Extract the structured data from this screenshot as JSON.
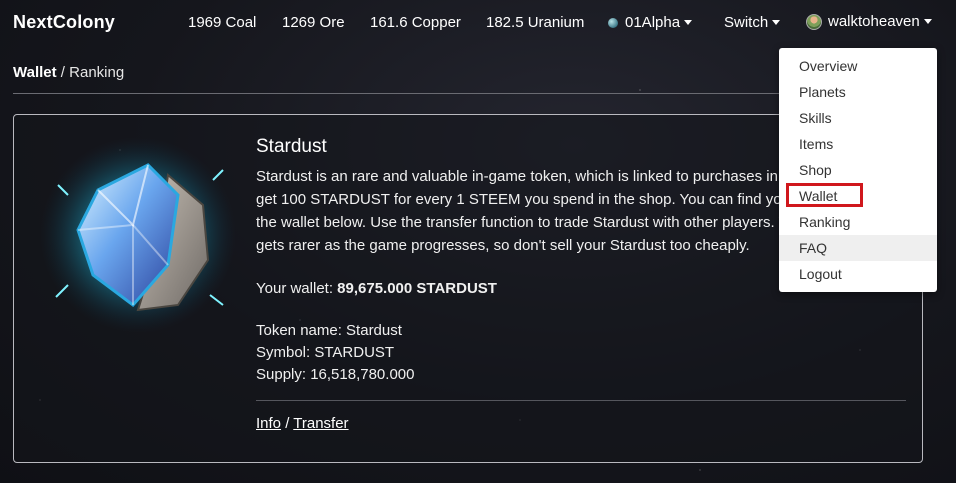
{
  "navbar": {
    "brand": "NextColony",
    "resources": {
      "coal": "1969 Coal",
      "ore": "1269 Ore",
      "copper": "161.6 Copper",
      "uranium": "182.5 Uranium"
    },
    "planet": "01Alpha",
    "switch_label": "Switch",
    "username": "walktoheaven"
  },
  "breadcrumb": {
    "wallet": "Wallet",
    "separator": "/",
    "ranking": "Ranking"
  },
  "token": {
    "title": "Stardust",
    "description": "Stardust is an rare and valuable in-game token, which is linked to purchases in the shop. You get 100 STARDUST for every 1 STEEM you spend in the shop. You can find your Stardust in the wallet below. Use the transfer function to trade Stardust with other players. Your Stardust gets rarer as the game progresses, so don't sell your Stardust too cheaply.",
    "wallet_prefix": "Your wallet: ",
    "wallet_value": "89,675.000 STARDUST",
    "token_name": "Token name: Stardust",
    "symbol": "Symbol: STARDUST",
    "supply": "Supply: 16,518,780.000",
    "link_info": "Info",
    "link_separator": " / ",
    "link_transfer": "Transfer"
  },
  "dropdown": {
    "items": [
      "Overview",
      "Planets",
      "Skills",
      "Items",
      "Shop",
      "Wallet",
      "Ranking",
      "FAQ",
      "Logout"
    ],
    "highlighted": "Wallet",
    "hovered": "FAQ"
  },
  "colors": {
    "highlight_border": "#d0171c",
    "background": "#15161c"
  }
}
